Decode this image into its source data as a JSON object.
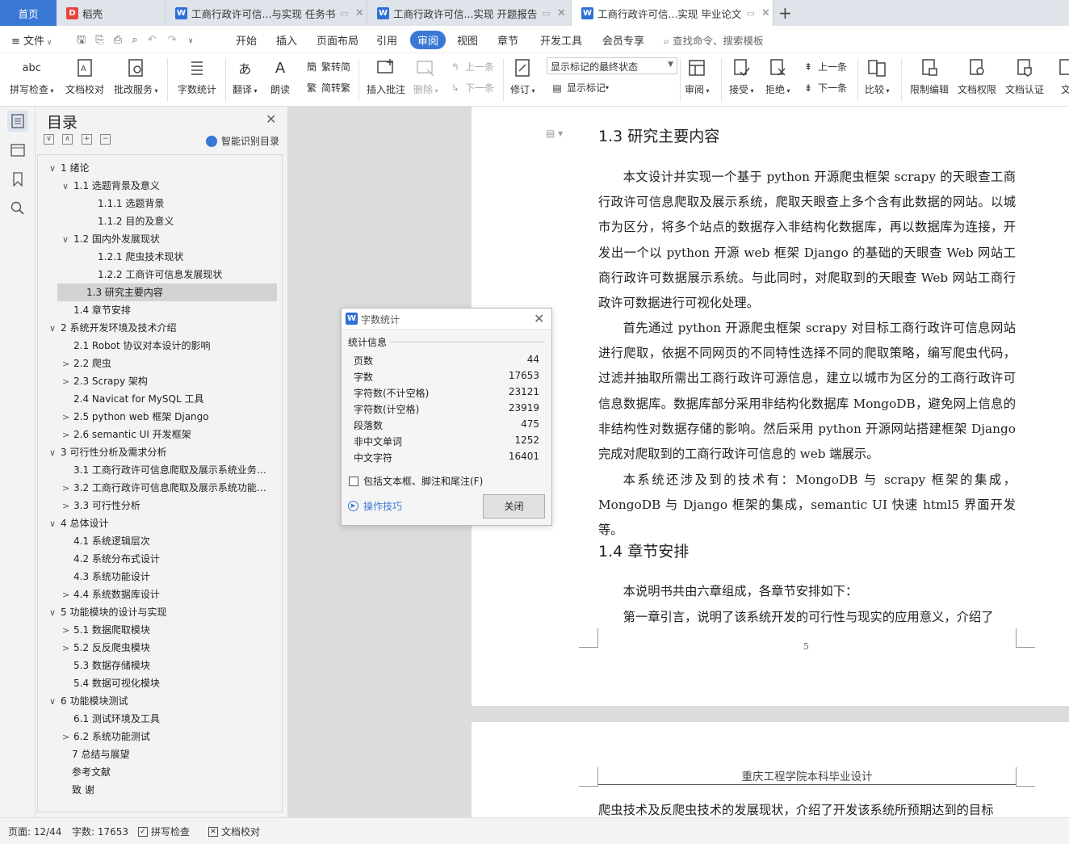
{
  "tabs": {
    "home": "首页",
    "daoke": "稻壳",
    "doc1": "工商行政许可信...与实现 任务书",
    "doc2": "工商行政许可信...实现 开题报告",
    "doc3": "工商行政许可信...实现 毕业论文"
  },
  "menu": {
    "file": "文件",
    "items": [
      "开始",
      "插入",
      "页面布局",
      "引用",
      "审阅",
      "视图",
      "章节",
      "开发工具",
      "会员专享"
    ],
    "search": "查找命令、搜索模板"
  },
  "ribbon": {
    "spell_check": "拼写检查",
    "doc_proof": "文档校对",
    "correction_service": "批改服务",
    "word_count": "字数统计",
    "translate": "翻译",
    "read_aloud": "朗读",
    "trad_to_simp": "繁转简",
    "simp_to_trad": "简转繁",
    "insert_comment": "插入批注",
    "delete": "删除",
    "prev_comment": "上一条",
    "next_comment": "下一条",
    "revise": "修订",
    "show_markup_state": "显示标记的最终状态",
    "show_markup": "显示标记",
    "review": "审阅",
    "accept": "接受",
    "reject": "拒绝",
    "prev_change": "上一条",
    "next_change": "下一条",
    "compare": "比较",
    "restrict_edit": "限制编辑",
    "doc_permission": "文档权限",
    "doc_auth": "文档认证",
    "doc_more": "文"
  },
  "toc": {
    "title": "目录",
    "smart": "智能识别目录",
    "items": [
      {
        "label": "1  绪论",
        "level": 0,
        "exp": "∨"
      },
      {
        "label": "1.1  选题背景及意义",
        "level": 1,
        "exp": "∨"
      },
      {
        "label": "1.1.1 选题背景",
        "level": 2,
        "exp": ""
      },
      {
        "label": "1.1.2 目的及意义",
        "level": 2,
        "exp": ""
      },
      {
        "label": "1.2  国内外发展现状",
        "level": 1,
        "exp": "∨"
      },
      {
        "label": "1.2.1  爬虫技术现状",
        "level": 2,
        "exp": ""
      },
      {
        "label": "1.2.2  工商许可信息发展现状",
        "level": 2,
        "exp": ""
      },
      {
        "label": "1.3  研究主要内容",
        "level": 1,
        "exp": ""
      },
      {
        "label": "1.4  章节安排",
        "level": 1,
        "exp": ""
      },
      {
        "label": "2  系统开发环境及技术介绍",
        "level": 0,
        "exp": "∨"
      },
      {
        "label": "2.1 Robot 协议对本设计的影响",
        "level": 1,
        "exp": ""
      },
      {
        "label": "2.2  爬虫",
        "level": 1,
        "exp": ">"
      },
      {
        "label": "2.3 Scrapy 架构",
        "level": 1,
        "exp": ">"
      },
      {
        "label": "2.4 Navicat for MySQL 工具",
        "level": 1,
        "exp": ""
      },
      {
        "label": "2.5 python web 框架 Django",
        "level": 1,
        "exp": ">"
      },
      {
        "label": "2.6 semantic UI 开发框架",
        "level": 1,
        "exp": ">"
      },
      {
        "label": "3  可行性分析及需求分析",
        "level": 0,
        "exp": "∨"
      },
      {
        "label": "3.1  工商行政许可信息爬取及展示系统业务…",
        "level": 1,
        "exp": ""
      },
      {
        "label": "3.2  工商行政许可信息爬取及展示系统功能…",
        "level": 1,
        "exp": ">"
      },
      {
        "label": "3.3  可行性分析",
        "level": 1,
        "exp": ">"
      },
      {
        "label": "4  总体设计",
        "level": 0,
        "exp": "∨"
      },
      {
        "label": "4.1  系统逻辑层次",
        "level": 1,
        "exp": ""
      },
      {
        "label": "4.2  系统分布式设计",
        "level": 1,
        "exp": ""
      },
      {
        "label": "4.3  系统功能设计",
        "level": 1,
        "exp": ""
      },
      {
        "label": "4.4  系统数据库设计",
        "level": 1,
        "exp": ">"
      },
      {
        "label": "5  功能模块的设计与实现",
        "level": 0,
        "exp": "∨"
      },
      {
        "label": "5.1  数据爬取模块",
        "level": 1,
        "exp": ">"
      },
      {
        "label": "5.2  反反爬虫模块",
        "level": 1,
        "exp": ">"
      },
      {
        "label": "5.3  数据存储模块",
        "level": 1,
        "exp": ""
      },
      {
        "label": "5.4  数据可视化模块",
        "level": 1,
        "exp": ""
      },
      {
        "label": "6  功能模块测试",
        "level": 0,
        "exp": "∨"
      },
      {
        "label": "6.1  测试环境及工具",
        "level": 1,
        "exp": ""
      },
      {
        "label": "6.2  系统功能测试",
        "level": 1,
        "exp": ">"
      },
      {
        "label": "7 总结与展望",
        "level": -1,
        "exp": ""
      },
      {
        "label": "参考文献",
        "level": -1,
        "exp": ""
      },
      {
        "label": "致    谢",
        "level": -1,
        "exp": ""
      }
    ]
  },
  "doc": {
    "h13": "1.3  研究主要内容",
    "p1": "本文设计并实现一个基于 python 开源爬虫框架 scrapy 的天眼查工商行政许可信息爬取及展示系统，爬取天眼查上多个含有此数据的网站。以城市为区分，将多个站点的数据存入非结构化数据库，再以数据库为连接，开发出一个以 python 开源 web 框架 Django 的基础的天眼查 Web 网站工商行政许可数据展示系统。与此同时，对爬取到的天眼查 Web 网站工商行政许可数据进行可视化处理。",
    "p2": "首先通过 python 开源爬虫框架 scrapy 对目标工商行政许可信息网站进行爬取，依据不同网页的不同特性选择不同的爬取策略，编写爬虫代码，过滤并抽取所需出工商行政许可源信息，建立以城市为区分的工商行政许可信息数据库。数据库部分采用非结构化数据库 MongoDB，避免网上信息的非结构性对数据存储的影响。然后采用 python 开源网站搭建框架 Django 完成对爬取到的工商行政许可信息的 web 端展示。",
    "p3": "本系统还涉及到的技术有：MongoDB 与 scrapy 框架的集成，MongoDB 与 Django 框架的集成，semantic UI 快速 html5 界面开发等。",
    "h14": "1.4  章节安排",
    "p4": "本说明书共由六章组成，各章节安排如下：",
    "p5": "第一章引言，说明了该系统开发的可行性与现实的应用意义，介绍了",
    "page_number": "5",
    "page2_header": "重庆工程学院本科毕业设计",
    "page2_text": "爬虫技术及反爬虫技术的发展现状，介绍了开发该系统所预期达到的目标"
  },
  "word_count_dialog": {
    "title": "字数统计",
    "section": "统计信息",
    "rows": [
      {
        "label": "页数",
        "value": "44"
      },
      {
        "label": "字数",
        "value": "17653"
      },
      {
        "label": "字符数(不计空格)",
        "value": "23121"
      },
      {
        "label": "字符数(计空格)",
        "value": "23919"
      },
      {
        "label": "段落数",
        "value": "475"
      },
      {
        "label": "非中文单词",
        "value": "1252"
      },
      {
        "label": "中文字符",
        "value": "16401"
      }
    ],
    "include_checkbox": "包括文本框、脚注和尾注(F)",
    "tips": "操作技巧",
    "close": "关闭"
  },
  "status": {
    "page": "页面: 12/44",
    "words": "字数: 17653",
    "spell": "拼写检查",
    "proof": "文档校对"
  },
  "colors": {
    "accent": "#3a78d6",
    "word_icon": "#2f6fd8",
    "daoke_icon": "#e5443d"
  }
}
